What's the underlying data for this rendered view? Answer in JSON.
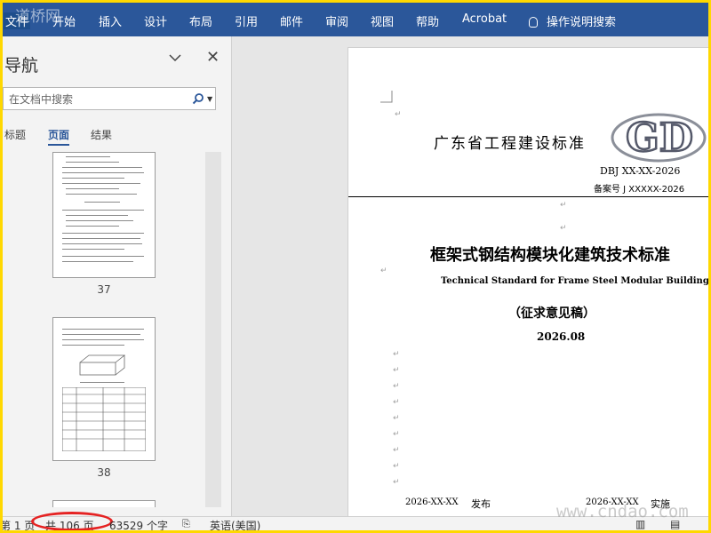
{
  "ribbon": {
    "tabs": [
      "文件",
      "开始",
      "插入",
      "设计",
      "布局",
      "引用",
      "邮件",
      "审阅",
      "视图",
      "帮助",
      "Acrobat"
    ],
    "tell_me": "操作说明搜索"
  },
  "nav": {
    "title": "导航",
    "search_placeholder": "在文档中搜索",
    "tabs": [
      "标题",
      "页面",
      "结果"
    ],
    "active_tab": "页面",
    "pages": [
      "37",
      "38"
    ]
  },
  "document": {
    "org_title": "广东省工程建设标准",
    "logo_text": "GD",
    "code": "DBJ XX-XX-2026",
    "filing": "备案号 J XXXXX-2026",
    "title_cn": "框架式钢结构模块化建筑技术标准",
    "title_en": "Technical Standard for Frame Steel Modular Buildings",
    "draft": "（征求意见稿）",
    "date": "2026.08",
    "publish_date": "2026-XX-XX",
    "publish_label": "发布",
    "implement_date": "2026-XX-XX",
    "implement_label": "实施",
    "para_mark": "↵"
  },
  "status": {
    "page": "第 1 页",
    "total": "共 106 页",
    "words": "63529 个字",
    "language": "英语(美国)"
  },
  "watermarks": {
    "top": "道桥网",
    "bottom": "www.cndao.com"
  },
  "colors": {
    "ribbon": "#2b579a",
    "frame": "#ffd800",
    "highlight": "#e52222"
  }
}
